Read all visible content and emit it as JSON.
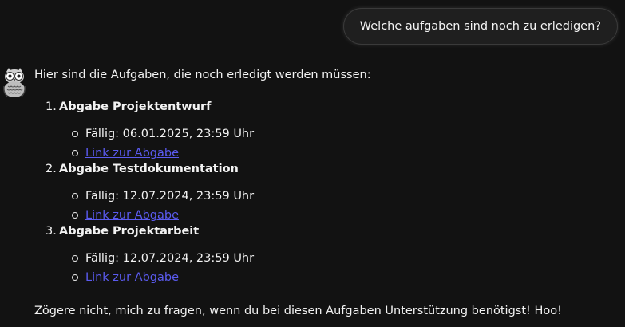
{
  "user_message": "Welche aufgaben sind noch zu erledigen?",
  "bot": {
    "avatar_icon": "owl-avatar-icon",
    "intro": "Hier sind die Aufgaben, die noch erledigt werden müssen:",
    "tasks": [
      {
        "number": "1.",
        "title": "Abgabe Projektentwurf",
        "due": "Fällig: 06.01.2025, 23:59 Uhr",
        "link_label": "Link zur Abgabe"
      },
      {
        "number": "2.",
        "title": "Abgabe Testdokumentation",
        "due": "Fällig: 12.07.2024, 23:59 Uhr",
        "link_label": "Link zur Abgabe"
      },
      {
        "number": "3.",
        "title": "Abgabe Projektarbeit",
        "due": "Fällig: 12.07.2024, 23:59 Uhr",
        "link_label": "Link zur Abgabe"
      }
    ],
    "outro": "Zögere nicht, mich zu fragen, wenn du bei diesen Aufgaben Unterstützung benötigst! Hoo!"
  },
  "colors": {
    "background": "#121212",
    "link": "#5b5bf0",
    "user_bubble": "#1f1f1f"
  }
}
